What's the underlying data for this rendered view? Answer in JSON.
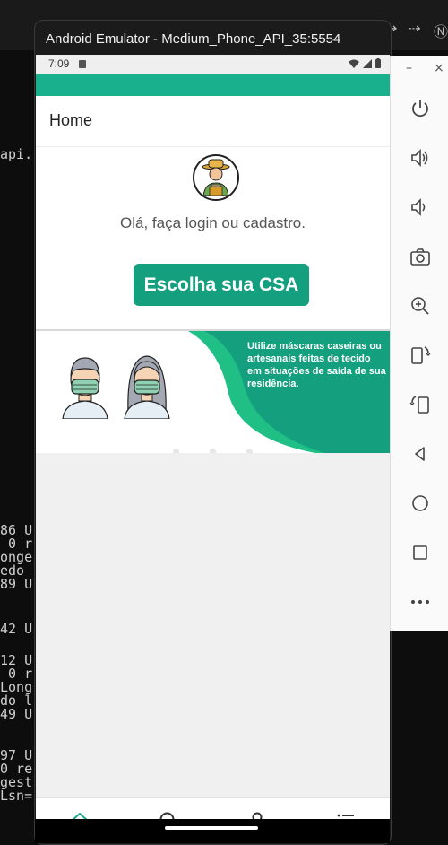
{
  "emulator": {
    "window_title": "Android Emulator - Medium_Phone_API_35:5554"
  },
  "terminal": {
    "lines_left": [
      "api.",
      "86 U",
      " 0 r",
      "onge",
      "edo ",
      "89 U",
      "42 U",
      "12 U",
      " 0 r",
      "Long",
      "do l",
      "49 U",
      "97 U",
      "0 re",
      "gest",
      "Lsn="
    ]
  },
  "status_bar": {
    "time": "7:09"
  },
  "app": {
    "header_title": "Home",
    "greeting": "Olá, faça login ou cadastro.",
    "cta_label": "Escolha sua CSA",
    "banner_text": "Utilize máscaras caseiras ou  artesanais feitas de tecido em situações de saída de sua residência.",
    "carousel_dots": 3,
    "accent_color": "#19b08e",
    "cta_color": "#14a07e"
  },
  "bottom_nav": {
    "items": [
      {
        "name": "home-icon",
        "active": true
      },
      {
        "name": "search-icon",
        "active": false
      },
      {
        "name": "profile-icon",
        "active": false
      },
      {
        "name": "menu-list-icon",
        "active": false
      }
    ]
  },
  "side_toolbar": {
    "tools": [
      "power-icon",
      "volume-up-icon",
      "volume-down-icon",
      "camera-icon",
      "zoom-in-icon",
      "rotate-left-icon",
      "rotate-right-icon",
      "back-icon",
      "home-circle-icon",
      "overview-icon",
      "more-icon"
    ]
  }
}
